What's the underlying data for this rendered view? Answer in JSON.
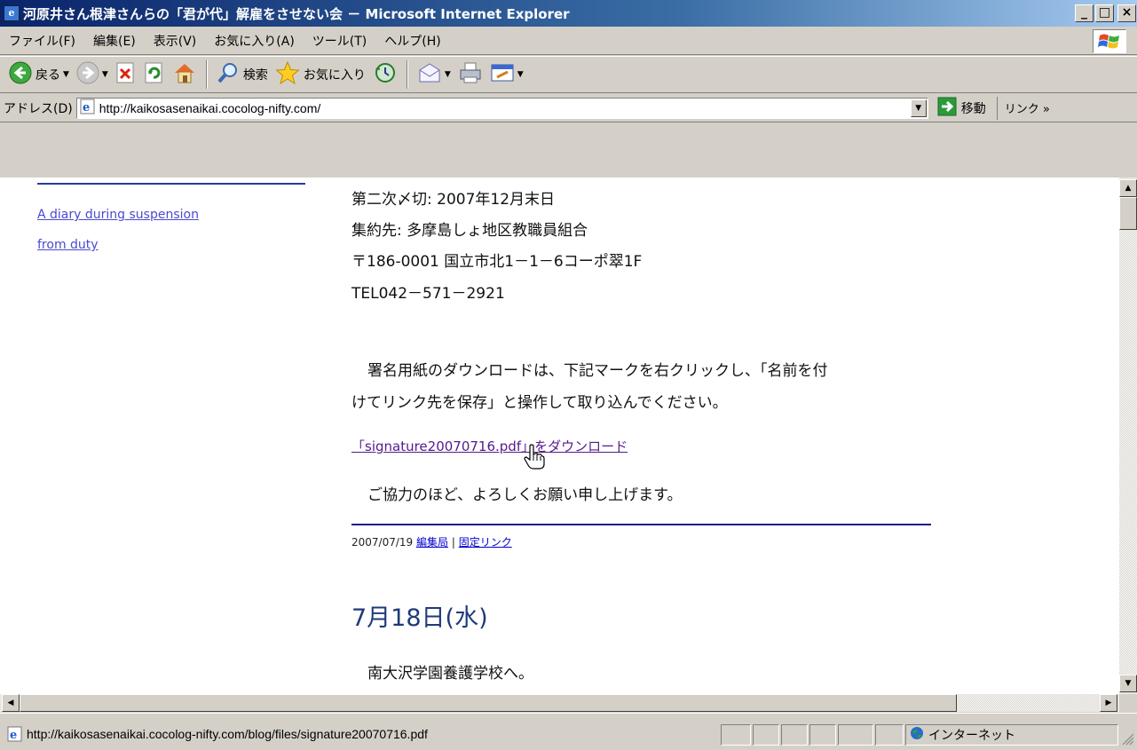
{
  "window": {
    "title": "河原井さん根津さんらの「君が代」解雇をさせない会 － Microsoft Internet Explorer",
    "minimize": "_",
    "maximize": "□",
    "close": "×"
  },
  "menu": [
    "ファイル(F)",
    "編集(E)",
    "表示(V)",
    "お気に入り(A)",
    "ツール(T)",
    "ヘルプ(H)"
  ],
  "toolbar": {
    "back_label": "戻る",
    "search_label": "検索",
    "favorites_label": "お気に入り"
  },
  "address": {
    "label": "アドレス(D)",
    "url": "http://kaikosasenaikai.cocolog-nifty.com/",
    "go_label": "移動",
    "links_label": "リンク »"
  },
  "sidebar": {
    "link_line1": "A diary during suspension",
    "link_line2": "from duty"
  },
  "article": {
    "line_deadline": "第二次〆切: 2007年12月末日",
    "line_collect": "集約先: 多摩島しょ地区教職員組合",
    "line_address": "〒186-0001 国立市北1－1－6コーポ翠1F",
    "line_tel": "TEL042－571－2921",
    "line_instr1": "署名用紙のダウンロードは、下記マークを右クリックし、「名前を付",
    "line_instr2": "けてリンク先を保存」と操作して取り込んでください。",
    "download_link": "「signature20070716.pdf」をダウンロード",
    "line_thanks": "ご協力のほど、よろしくお願い申し上げます。",
    "meta_date": "2007/07/19",
    "meta_author": "編集局",
    "meta_sep": "|",
    "meta_permalink": "固定リンク",
    "next_heading": "7月18日(水)",
    "next_line": "南大沢学園養護学校へ。"
  },
  "status": {
    "text": "http://kaikosasenaikai.cocolog-nifty.com/blog/files/signature20070716.pdf",
    "zone": "インターネット"
  }
}
